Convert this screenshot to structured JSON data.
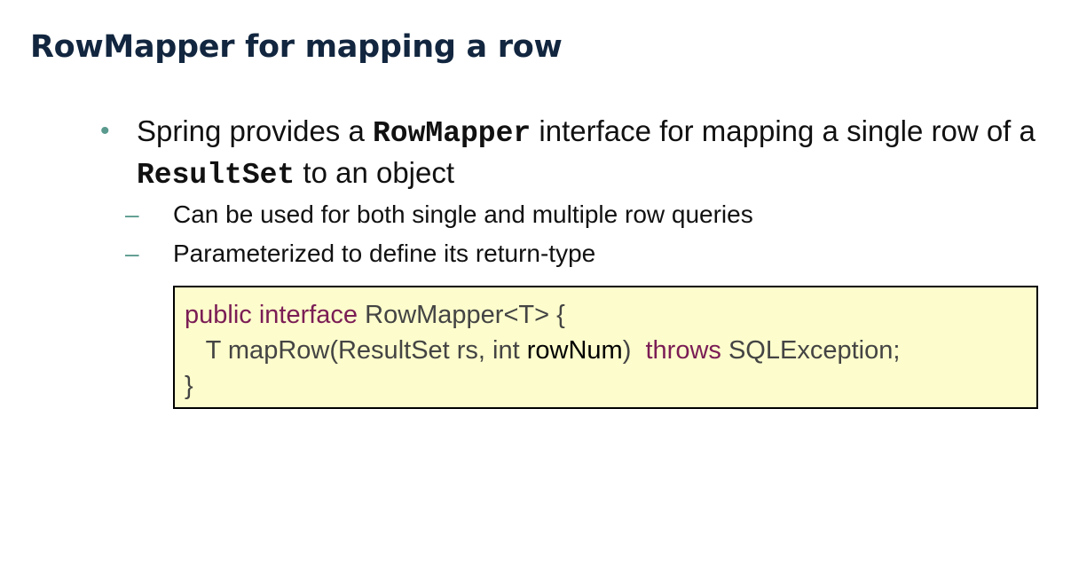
{
  "title": "RowMapper for mapping a row",
  "bullet": {
    "text_1": "Spring provides a ",
    "code_1": "RowMapper",
    "text_2": " interface for mapping a single row of a ",
    "code_2": "ResultSet",
    "text_3": " to an object"
  },
  "sub_bullets": [
    "Can be used for both single and multiple row queries",
    "Parameterized to define its return-type"
  ],
  "code": {
    "line1": {
      "kw": "public interface",
      "rest": " RowMapper<T> {"
    },
    "line2": {
      "indent": "   ",
      "part1": "T mapRow(ResultSet rs, int ",
      "param": "rowNum",
      "part2": ")  ",
      "kw": "throws",
      "part3": " SQLException;"
    },
    "line3": "}"
  },
  "colors": {
    "title": "#12263f",
    "bullet_marker": "#5a9a8e",
    "code_background": "#fcfccc",
    "code_keyword": "#7b1d55",
    "code_text": "#444444"
  }
}
